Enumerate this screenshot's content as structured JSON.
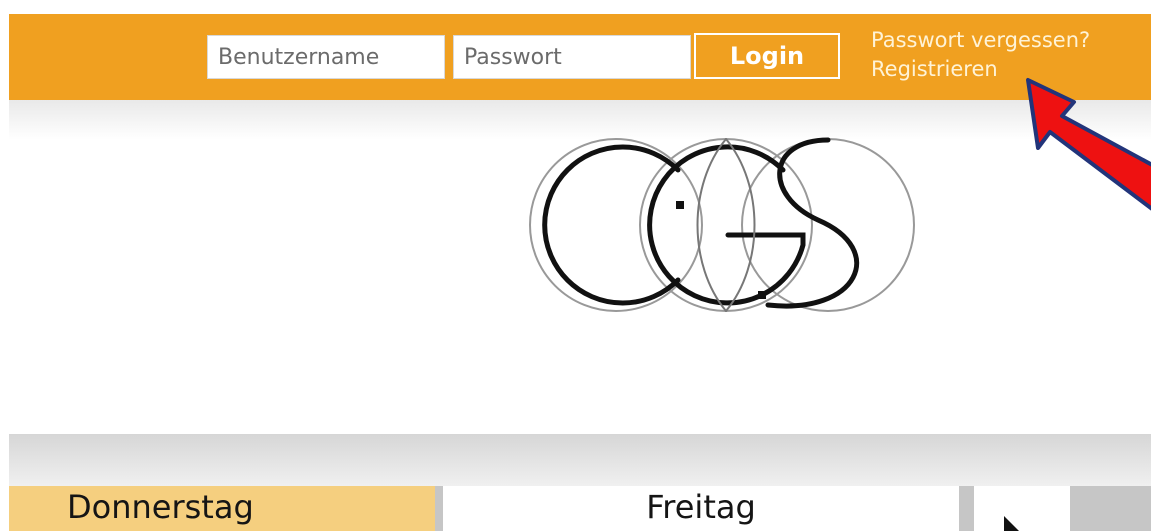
{
  "header": {
    "username_placeholder": "Benutzername",
    "password_placeholder": "Passwort",
    "login_label": "Login",
    "forgot_password_link": "Passwort vergessen?",
    "register_link": "Registrieren"
  },
  "logo": {
    "text": "CGS"
  },
  "day_tabs": {
    "current": "Donnerstag",
    "next": "Freitag"
  },
  "colors": {
    "header_bg": "#f0a020",
    "active_tab": "#f5cf7f",
    "arrow_annotation": "#ee1111"
  },
  "icons": {
    "next_day": "triangle-right-icon",
    "annotation": "red-arrow-icon"
  }
}
